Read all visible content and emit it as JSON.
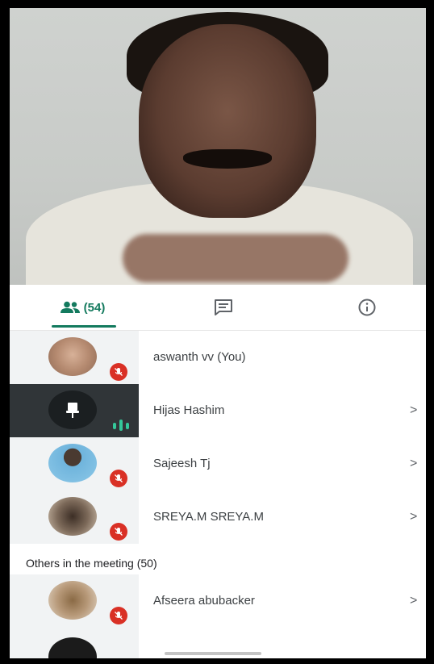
{
  "tabs": {
    "people_count": "(54)",
    "chat_label": "",
    "info_label": ""
  },
  "participants": [
    {
      "name": "aswanth vv (You)",
      "muted": true
    },
    {
      "name": "Hijas Hashim",
      "muted": false,
      "speaking": true
    },
    {
      "name": "Sajeesh Tj",
      "muted": true
    },
    {
      "name": "SREYA.M SREYA.M",
      "muted": true
    }
  ],
  "others": {
    "header": "Others in the meeting (50)",
    "items": [
      {
        "name": "Afseera abubacker",
        "muted": true
      }
    ]
  },
  "colors": {
    "accent": "#137a5e",
    "muted_badge": "#d93025",
    "active_row": "#303538"
  }
}
